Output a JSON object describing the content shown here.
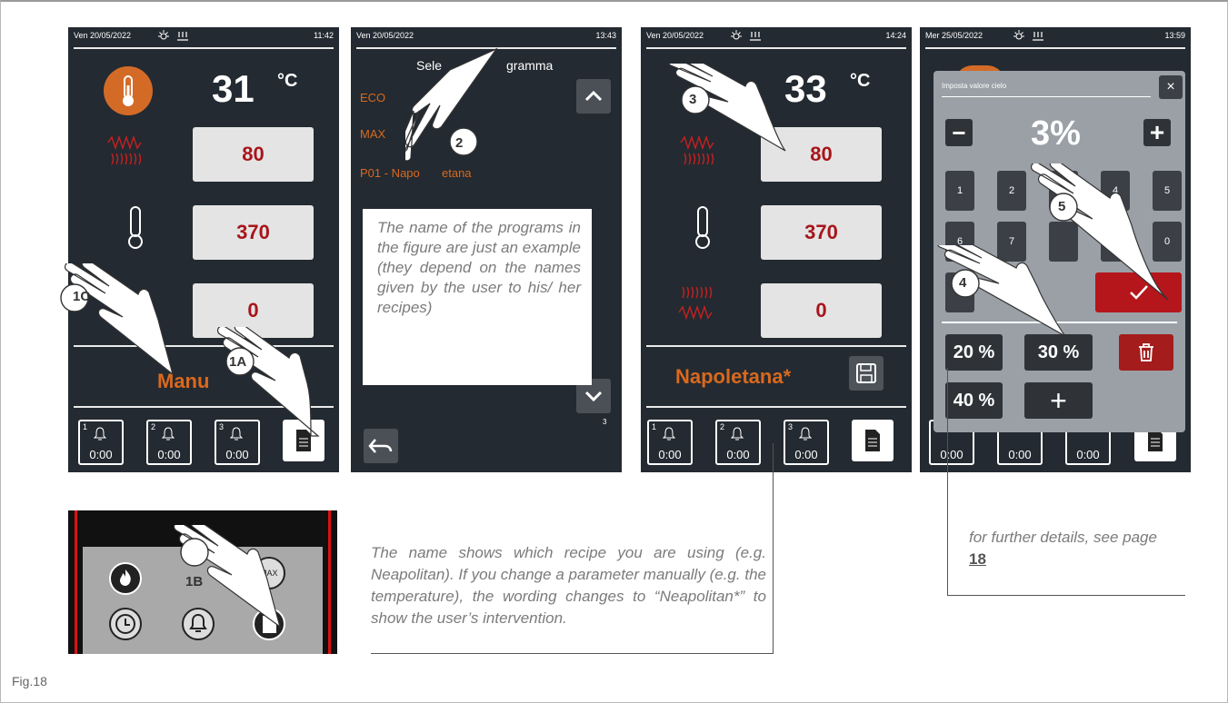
{
  "figure": {
    "label": "Fig.18"
  },
  "screen1": {
    "date": "Ven 20/05/2022",
    "time": "11:42",
    "temp": "31",
    "unit": "°C",
    "values": [
      "80",
      "370",
      "0"
    ],
    "mode": "Manu",
    "timers": [
      {
        "n": "1",
        "t": "0:00"
      },
      {
        "n": "2",
        "t": "0:00"
      },
      {
        "n": "3",
        "t": "0:00"
      }
    ]
  },
  "screen2": {
    "date": "Ven 20/05/2022",
    "time": "13:43",
    "title_left": "Sele",
    "title_right": "gramma",
    "programs": [
      "ECO",
      "MAX",
      "P01 - Napo",
      "etana"
    ],
    "page": "3",
    "note": "The name of the programs in the figure are just an example (they depend on the names given by the user to his/ her recipes)"
  },
  "screen3": {
    "date": "Ven 20/05/2022",
    "time": "14:24",
    "temp": "33",
    "unit": "°C",
    "values": [
      "80",
      "370",
      "0"
    ],
    "recipe": "Napoletana*",
    "timers": [
      {
        "n": "1",
        "t": "0:00"
      },
      {
        "n": "2",
        "t": "0:00"
      },
      {
        "n": "3",
        "t": "0:00"
      }
    ]
  },
  "screen4": {
    "date": "Mer 25/05/2022",
    "time": "13:59",
    "dialog_title": "Imposta valore cielo",
    "close": "×",
    "value": "3%",
    "minus": "−",
    "plus": "+",
    "keys_row1": [
      "1",
      "2",
      "",
      "4",
      "5"
    ],
    "keys_row2": [
      "6",
      "7",
      "",
      "",
      "0"
    ],
    "presets": [
      "20 %",
      "30 %",
      "40 %"
    ],
    "timers_partial": [
      "0:00",
      "0:00",
      "0:00"
    ]
  },
  "steps": [
    "1C",
    "1A",
    "1B",
    "2",
    "3",
    "4",
    "5"
  ],
  "captions": {
    "recipe_name": "The name shows which recipe you are using (e.g. Neapolitan). If you change a parameter manually (e.g. the temperature), the wording changes to “Neapolitan*” to show the user’s intervention.",
    "details_prefix": "for further details, see page ",
    "details_page": "18"
  },
  "colors": {
    "screen_bg": "#232a31",
    "accent_orange": "#d9691e",
    "value_red": "#a8151b",
    "confirm_red": "#b5161b"
  },
  "icons": [
    "thermometer-icon",
    "heater-wave-icon",
    "bell-icon",
    "document-icon",
    "save-icon",
    "back-arrow-icon",
    "chevron-up-icon",
    "chevron-down-icon",
    "trash-icon",
    "check-icon",
    "flame-icon",
    "clock-icon",
    "max-icon",
    "hand-pointer-icon"
  ]
}
